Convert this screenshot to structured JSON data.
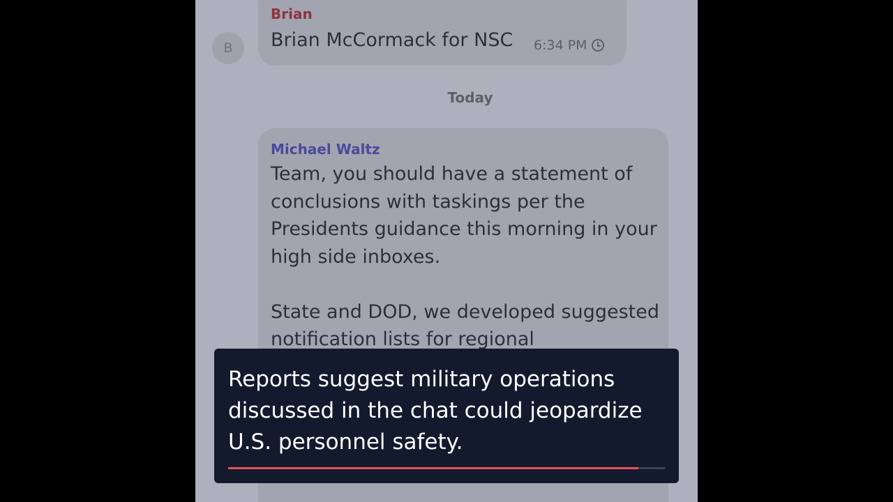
{
  "chat": {
    "messages": [
      {
        "avatar_letter": "B",
        "sender": "Brian",
        "text": "Brian McCormack for NSC",
        "time": "6:34 PM",
        "status_icon": "clock-icon"
      },
      {
        "sender": "Michael Waltz",
        "text": "Team, you should have a statement of conclusions with taskings per the Presidents guidance this morning in your high side inboxes.\n\nState and DOD, we developed suggested notification lists for regional"
      }
    ],
    "date_separator": "Today"
  },
  "caption": {
    "text": "Reports suggest military operations discussed in the chat could jeopardize U.S. personnel safety.",
    "progress": 0.94
  },
  "colors": {
    "accent": "#e8525a",
    "caption_bg": "#131a2e",
    "sender_brian": "#8d343d",
    "sender_michael": "#4b4a9a"
  }
}
